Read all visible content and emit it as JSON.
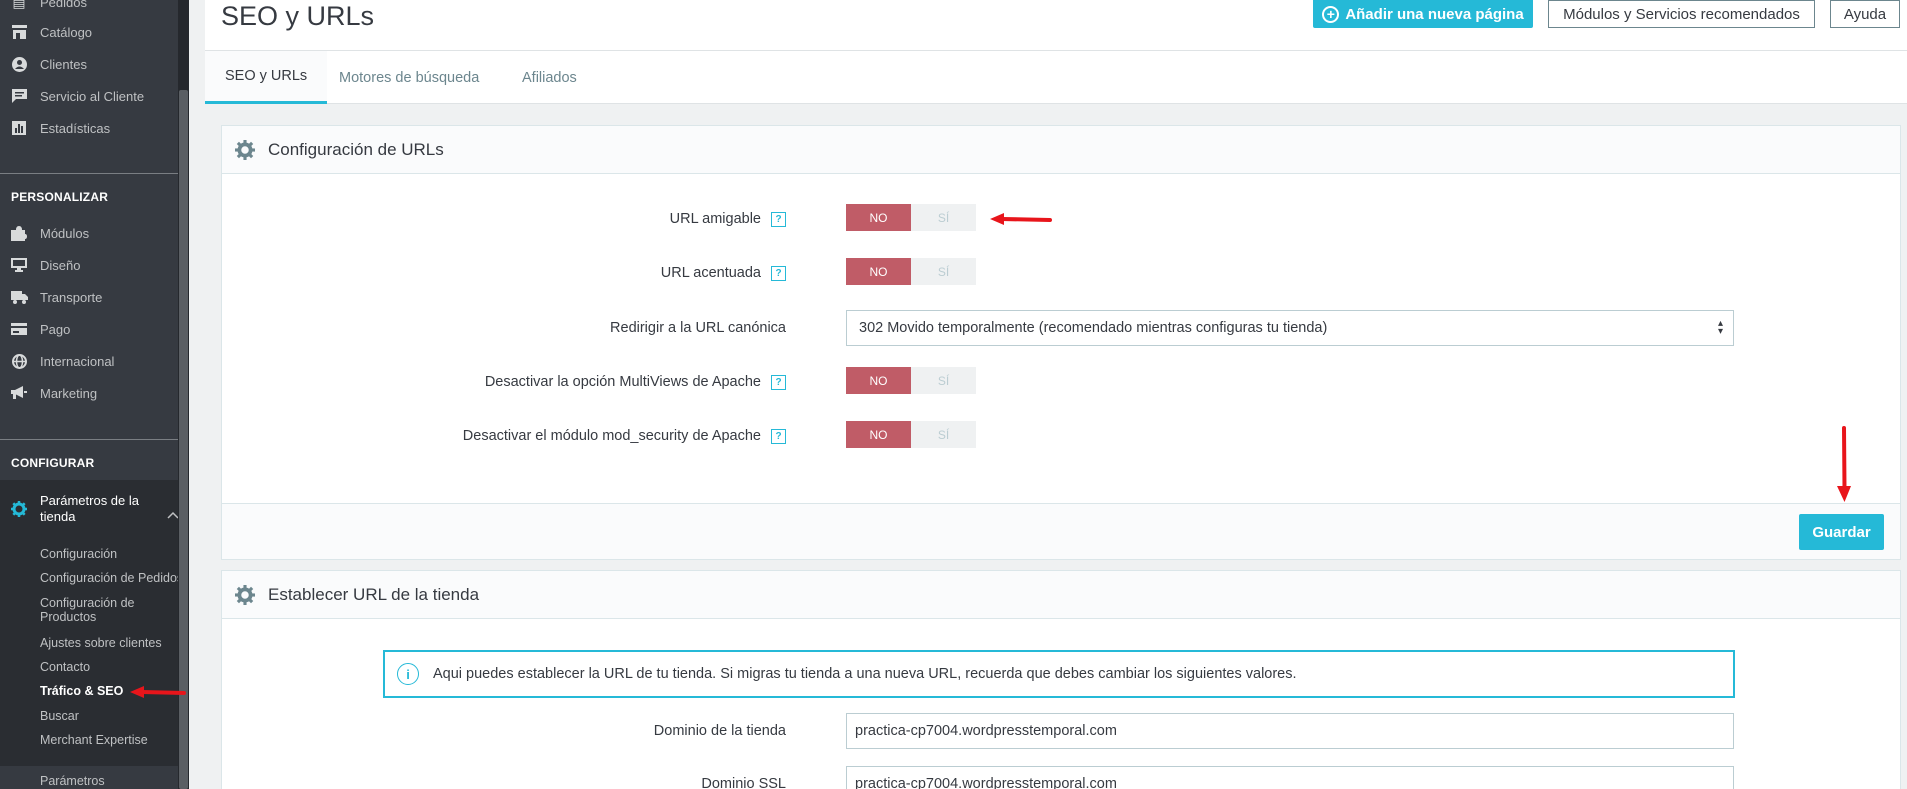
{
  "sidebar": {
    "top_items": [
      {
        "label": "Pedidos",
        "icon": "inbox-icon"
      },
      {
        "label": "Catálogo",
        "icon": "store-icon"
      },
      {
        "label": "Clientes",
        "icon": "user-icon"
      },
      {
        "label": "Servicio al Cliente",
        "icon": "chat-icon"
      },
      {
        "label": "Estadísticas",
        "icon": "chart-icon"
      }
    ],
    "section_personalizar": "PERSONALIZAR",
    "personalizar_items": [
      {
        "label": "Módulos",
        "icon": "puzzle-icon"
      },
      {
        "label": "Diseño",
        "icon": "desktop-icon"
      },
      {
        "label": "Transporte",
        "icon": "truck-icon"
      },
      {
        "label": "Pago",
        "icon": "card-icon"
      },
      {
        "label": "Internacional",
        "icon": "globe-icon"
      },
      {
        "label": "Marketing",
        "icon": "megaphone-icon"
      }
    ],
    "section_configurar": "CONFIGURAR",
    "active_parent": "Parámetros de la tienda",
    "sub_items": [
      "Configuración",
      "Configuración de Pedidos",
      "Configuración de Productos",
      "Ajustes sobre clientes",
      "Contacto",
      "Tráfico & SEO",
      "Buscar",
      "Merchant Expertise"
    ],
    "active_sub": "Tráfico & SEO",
    "bottom_item": "Parámetros"
  },
  "header": {
    "title": "SEO y URLs",
    "add_page": "Añadir una nueva página",
    "modules": "Módulos y Servicios recomendados",
    "help": "Ayuda"
  },
  "tabs": [
    "SEO y URLs",
    "Motores de búsqueda",
    "Afiliados"
  ],
  "url_config": {
    "title": "Configuración de URLs",
    "fields": [
      {
        "label": "URL amigable",
        "no": "NO",
        "yes": "SÍ"
      },
      {
        "label": "URL acentuada",
        "no": "NO",
        "yes": "SÍ"
      },
      {
        "label": "Desactivar la opción MultiViews de Apache",
        "no": "NO",
        "yes": "SÍ"
      },
      {
        "label": "Desactivar el módulo mod_security de Apache",
        "no": "NO",
        "yes": "SÍ"
      }
    ],
    "canonical_label": "Redirigir a la URL canónica",
    "canonical_value": "302 Movido temporalmente (recomendado mientras configuras tu tienda)",
    "save": "Guardar"
  },
  "shop_url": {
    "title": "Establecer URL de la tienda",
    "info": "Aqui puedes establecer la URL de tu tienda. Si migras tu tienda a una nueva URL, recuerda que debes cambiar los siguientes valores.",
    "domain_label": "Dominio de la tienda",
    "domain_value": "practica-cp7004.wordpresstemporal.com",
    "ssl_label": "Dominio SSL",
    "ssl_value": "practica-cp7004.wordpresstemporal.com"
  },
  "colors": {
    "accent": "#25b9d7",
    "toggle_no": "#c05c67",
    "sidebar": "#363a41",
    "annotation_arrow": "#e8151b"
  }
}
